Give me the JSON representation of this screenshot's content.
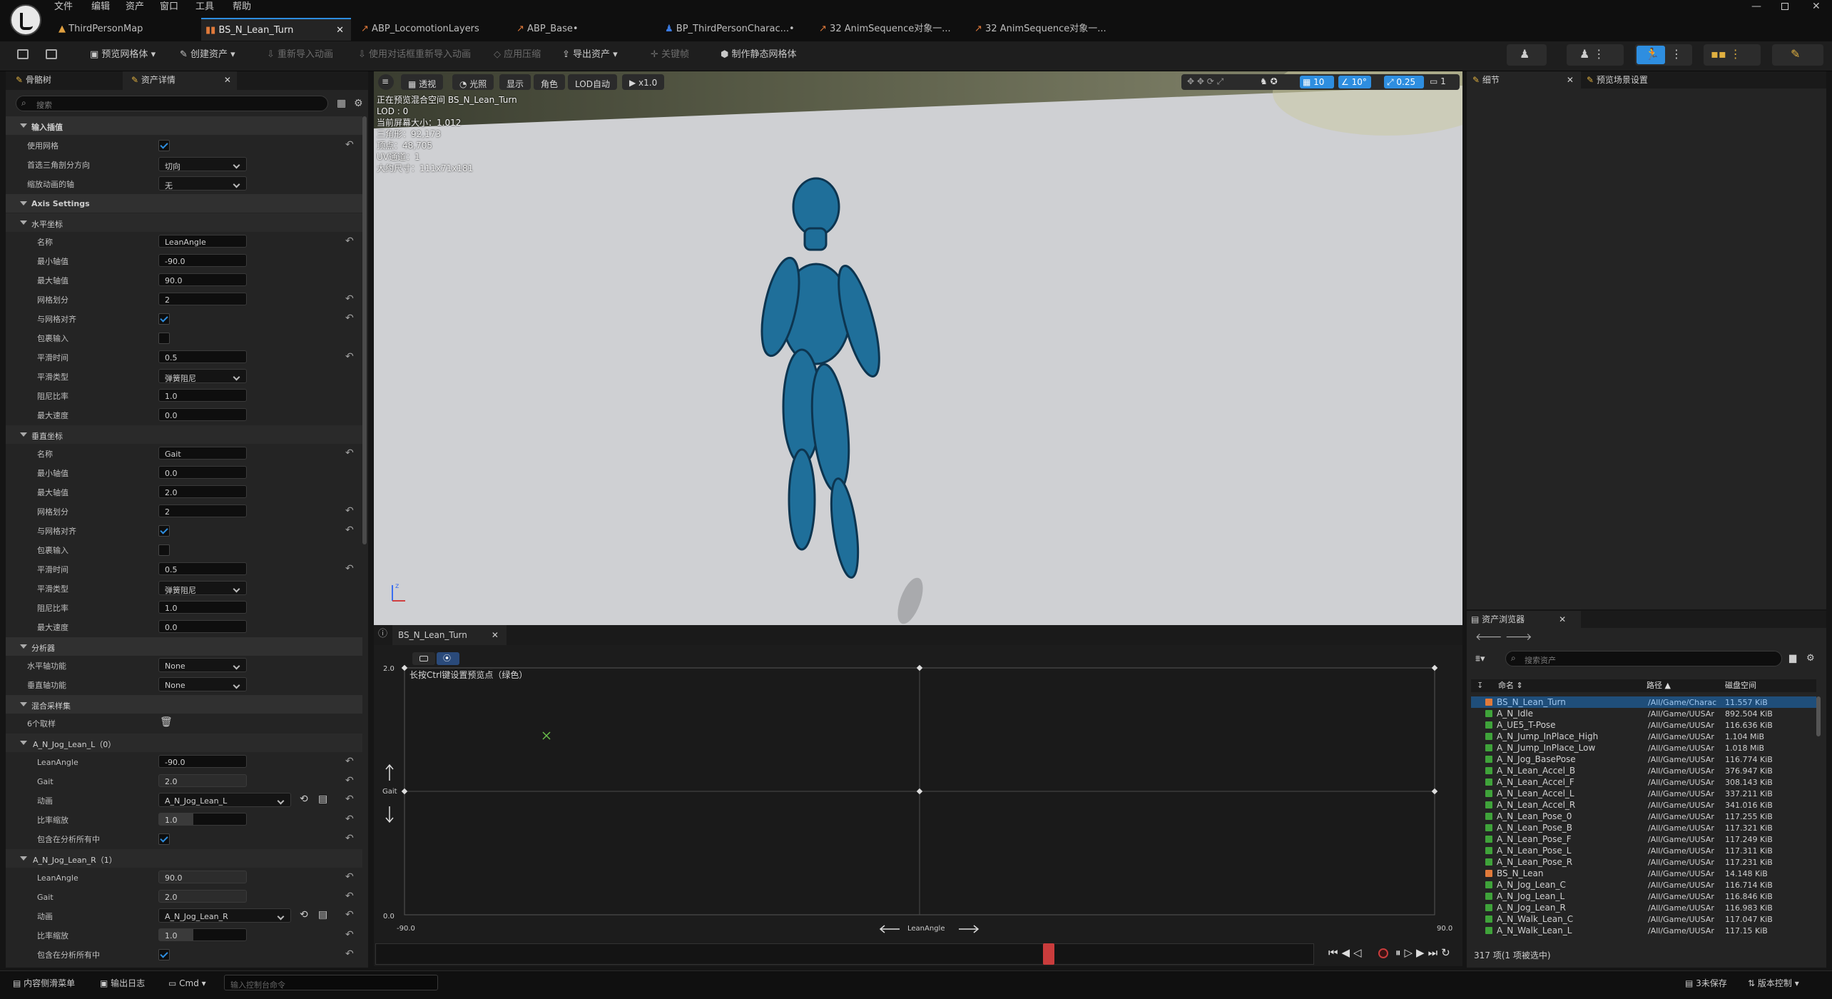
{
  "menu": [
    "文件",
    "编辑",
    "资产",
    "窗口",
    "工具",
    "帮助"
  ],
  "tabs": [
    "ThirdPersonMap",
    "BS_N_Lean_Turn",
    "ABP_LocomotionLayers",
    "ABP_Base•",
    "BP_ThirdPersonCharac...•",
    "32 AnimSequence对象一...",
    "32 AnimSequence对象一..."
  ],
  "toolbar": {
    "preview_mesh": "预览网格体",
    "create_asset": "创建资产",
    "reimport": "重新导入动画",
    "reimport_dialog": "使用对话框重新导入动画",
    "apply_compression": "应用压缩",
    "export_asset": "导出资产",
    "key": "关键帧",
    "make_static": "制作静态网格体"
  },
  "left_tabs": {
    "skeleton": "骨骼树",
    "details": "资产详情"
  },
  "search_placeholder": "搜索",
  "input_interp": {
    "title": "输入插值",
    "use_grid": "使用网格",
    "tri_dir": "首选三角剖分方向",
    "tri_dir_val": "切向",
    "scale_axis": "缩放动画的轴",
    "scale_axis_val": "无"
  },
  "axis_settings": "Axis Settings",
  "horizontal": {
    "title": "水平坐标",
    "name_l": "名称",
    "name": "LeanAngle",
    "min_l": "最小轴值",
    "min": "-90.0",
    "max_l": "最大轴值",
    "max": "90.0",
    "div_l": "网格划分",
    "div": "2",
    "snap_l": "与网格对齐",
    "wrap_l": "包裹输入",
    "smooth_l": "平滑时间",
    "smooth": "0.5",
    "stype_l": "平滑类型",
    "stype": "弹簧阻尼",
    "damp_l": "阻尼比率",
    "damp": "1.0",
    "speed_l": "最大速度",
    "speed": "0.0"
  },
  "vertical": {
    "title": "垂直坐标",
    "name_l": "名称",
    "name": "Gait",
    "min_l": "最小轴值",
    "min": "0.0",
    "max_l": "最大轴值",
    "max": "2.0",
    "div_l": "网格划分",
    "div": "2",
    "snap_l": "与网格对齐",
    "wrap_l": "包裹输入",
    "smooth_l": "平滑时间",
    "smooth": "0.5",
    "stype_l": "平滑类型",
    "stype": "弹簧阻尼",
    "damp_l": "阻尼比率",
    "damp": "1.0",
    "speed_l": "最大速度",
    "speed": "0.0"
  },
  "analysis": {
    "title": "分析器",
    "h_l": "水平轴功能",
    "h": "None",
    "v_l": "垂直轴功能",
    "v": "None"
  },
  "samples": {
    "title": "混合采样集",
    "count": "6个取样"
  },
  "sample0": {
    "title": "A_N_Jog_Lean_L（0）",
    "lean_l": "LeanAngle",
    "lean": "-90.0",
    "gait_l": "Gait",
    "gait": "2.0",
    "anim_l": "动画",
    "anim": "A_N_Jog_Lean_L",
    "rate_l": "比率缩放",
    "rate": "1.0",
    "inc_l": "包含在分析所有中"
  },
  "sample1": {
    "title": "A_N_Jog_Lean_R（1）",
    "lean_l": "LeanAngle",
    "lean": "90.0",
    "gait_l": "Gait",
    "gait": "2.0",
    "anim_l": "动画",
    "anim": "A_N_Jog_Lean_R",
    "rate_l": "比率缩放",
    "rate": "1.0",
    "inc_l": "包含在分析所有中"
  },
  "viewport": {
    "perspective": "透视",
    "lit": "光照",
    "show": "显示",
    "char": "角色",
    "lod": "LOD自动",
    "speed": "x1.0",
    "info": [
      "正在预览混合空间 BS_N_Lean_Turn",
      "LOD : 0",
      "当前屏幕大小：1.012",
      "三角形：92,173",
      "顶点：48,705",
      "UV通道：1",
      "大约尺寸：111x71x181"
    ],
    "grid": "10",
    "angle": "10°",
    "scale": "0.25",
    "cam": "1"
  },
  "right_tabs": {
    "details": "细节",
    "preview": "预览场景设置"
  },
  "bs_editor": {
    "tab": "BS_N_Lean_Turn",
    "hint": "长按Ctrl键设置预览点（绿色）",
    "y_max": "2.0",
    "y_min": "0.0",
    "x_min": "-90.0",
    "x_max": "90.0",
    "y_axis": "Gait",
    "x_axis": "LeanAngle"
  },
  "asset_browser": {
    "tab": "资产浏览器",
    "search": "搜索资产",
    "col_name": "命名",
    "col_path": "路径",
    "col_size": "磁盘空间",
    "count": "317 项(1 项被选中)",
    "items": [
      {
        "name": "BS_N_Lean_Turn",
        "path": "/All/Game/Charac",
        "size": "11.557 KiB",
        "type": "bs"
      },
      {
        "name": "A_N_Idle",
        "path": "/All/Game/UUSAr",
        "size": "892.504 KiB",
        "type": "anim"
      },
      {
        "name": "A_UE5_T-Pose",
        "path": "/All/Game/UUSAr",
        "size": "116.636 KiB",
        "type": "anim"
      },
      {
        "name": "A_N_Jump_InPlace_High",
        "path": "/All/Game/UUSAr",
        "size": "1.104 MiB",
        "type": "anim"
      },
      {
        "name": "A_N_Jump_InPlace_Low",
        "path": "/All/Game/UUSAr",
        "size": "1.018 MiB",
        "type": "anim"
      },
      {
        "name": "A_N_Jog_BasePose",
        "path": "/All/Game/UUSAr",
        "size": "116.774 KiB",
        "type": "anim"
      },
      {
        "name": "A_N_Lean_Accel_B",
        "path": "/All/Game/UUSAr",
        "size": "376.947 KiB",
        "type": "anim"
      },
      {
        "name": "A_N_Lean_Accel_F",
        "path": "/All/Game/UUSAr",
        "size": "308.143 KiB",
        "type": "anim"
      },
      {
        "name": "A_N_Lean_Accel_L",
        "path": "/All/Game/UUSAr",
        "size": "337.211 KiB",
        "type": "anim"
      },
      {
        "name": "A_N_Lean_Accel_R",
        "path": "/All/Game/UUSAr",
        "size": "341.016 KiB",
        "type": "anim"
      },
      {
        "name": "A_N_Lean_Pose_0",
        "path": "/All/Game/UUSAr",
        "size": "117.255 KiB",
        "type": "anim"
      },
      {
        "name": "A_N_Lean_Pose_B",
        "path": "/All/Game/UUSAr",
        "size": "117.321 KiB",
        "type": "anim"
      },
      {
        "name": "A_N_Lean_Pose_F",
        "path": "/All/Game/UUSAr",
        "size": "117.249 KiB",
        "type": "anim"
      },
      {
        "name": "A_N_Lean_Pose_L",
        "path": "/All/Game/UUSAr",
        "size": "117.311 KiB",
        "type": "anim"
      },
      {
        "name": "A_N_Lean_Pose_R",
        "path": "/All/Game/UUSAr",
        "size": "117.231 KiB",
        "type": "anim"
      },
      {
        "name": "BS_N_Lean",
        "path": "/All/Game/UUSAr",
        "size": "14.148 KiB",
        "type": "bs"
      },
      {
        "name": "A_N_Jog_Lean_C",
        "path": "/All/Game/UUSAr",
        "size": "116.714 KiB",
        "type": "anim"
      },
      {
        "name": "A_N_Jog_Lean_L",
        "path": "/All/Game/UUSAr",
        "size": "116.846 KiB",
        "type": "anim"
      },
      {
        "name": "A_N_Jog_Lean_R",
        "path": "/All/Game/UUSAr",
        "size": "116.983 KiB",
        "type": "anim"
      },
      {
        "name": "A_N_Walk_Lean_C",
        "path": "/All/Game/UUSAr",
        "size": "117.047 KiB",
        "type": "anim"
      },
      {
        "name": "A_N_Walk_Lean_L",
        "path": "/All/Game/UUSAr",
        "size": "117.15 KiB",
        "type": "anim"
      }
    ]
  },
  "status": {
    "drawer": "内容侧滑菜单",
    "log": "输出日志",
    "cmd": "Cmd",
    "cmd_placeholder": "输入控制台命令",
    "unsaved": "3未保存",
    "version": "版本控制"
  },
  "colors": {
    "accent": "#2e8ee0",
    "selected": "#1f4e7a",
    "anim_icon": "#3fa33a",
    "bs_icon": "#e07a3a",
    "marker": "#c93c3c"
  }
}
